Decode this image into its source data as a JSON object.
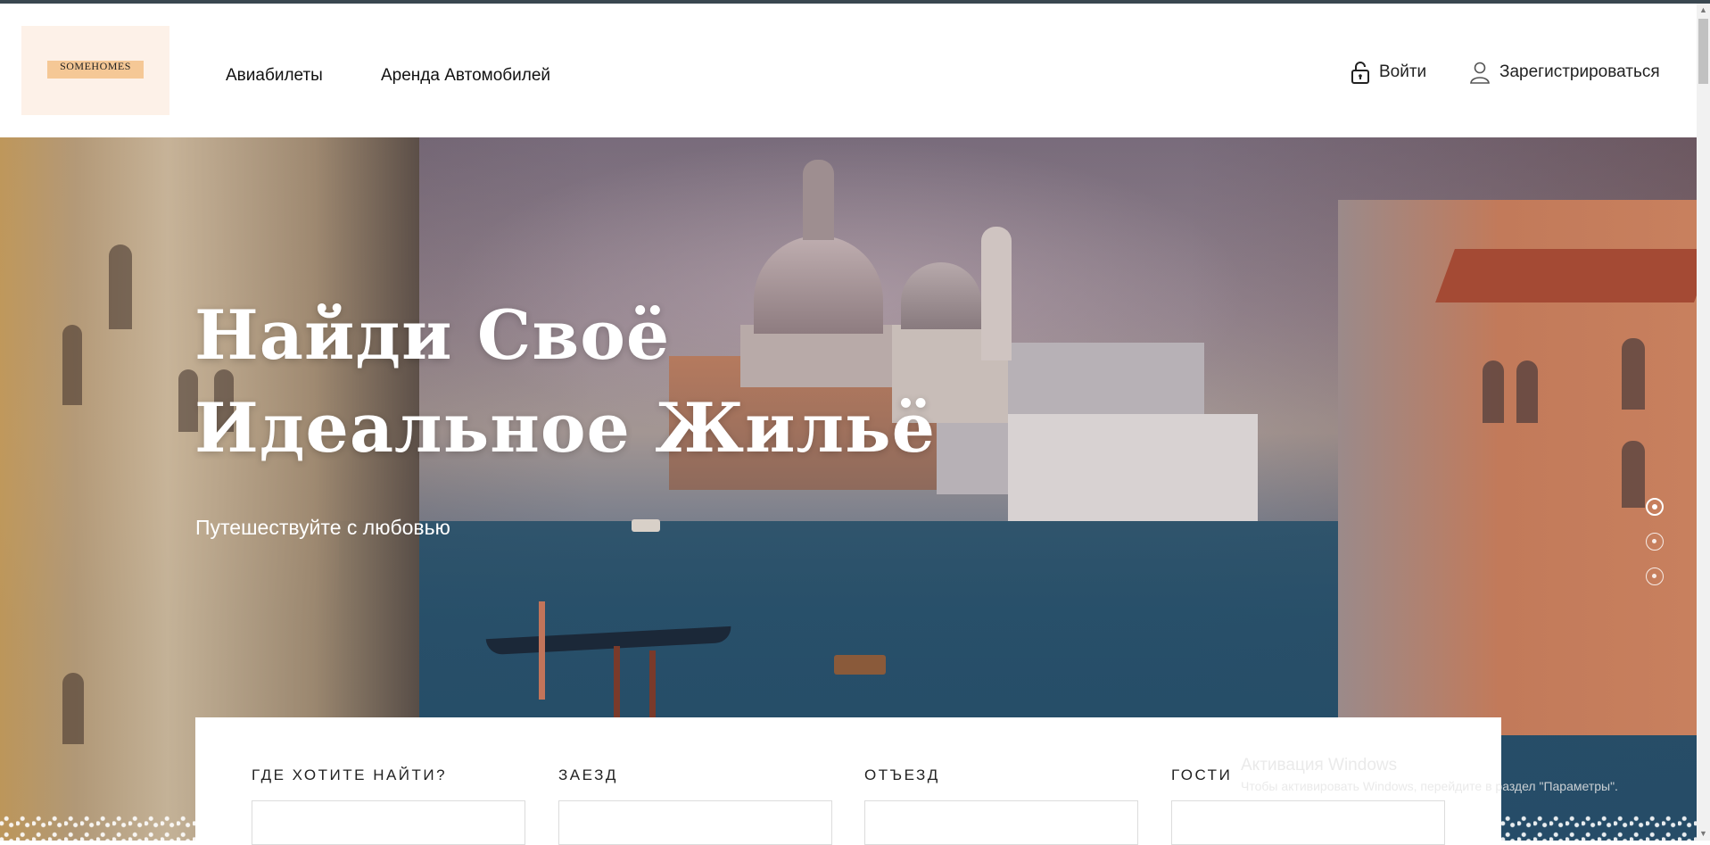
{
  "header": {
    "logo_text": "SOMEHOMES",
    "nav": [
      {
        "label": "Авиабилеты"
      },
      {
        "label": "Аренда Автомобилей"
      }
    ],
    "auth": {
      "login_label": "Войти",
      "login_icon": "lock-icon",
      "register_label": "Зарегистрироваться",
      "register_icon": "user-icon"
    }
  },
  "hero": {
    "title": "Найди Своё\nИдеальное Жильё",
    "subtitle": "Путешествуйте с любовью",
    "slides": {
      "count": 3,
      "active_index": 0
    }
  },
  "search": {
    "fields": [
      {
        "label": "ГДЕ ХОТИТЕ НАЙТИ?",
        "value": ""
      },
      {
        "label": "ЗАЕЗД",
        "value": ""
      },
      {
        "label": "ОТЪЕЗД",
        "value": ""
      },
      {
        "label": "ГОСТИ",
        "value": ""
      }
    ]
  },
  "windows_activation": {
    "title": "Активация Windows",
    "subtitle": "Чтобы активировать Windows, перейдите в раздел \"Параметры\"."
  },
  "colors": {
    "topline": "#3a4750",
    "logo_bg": "#fdf1e8",
    "logo_strip": "#f5c896",
    "text_dark": "#111111"
  }
}
